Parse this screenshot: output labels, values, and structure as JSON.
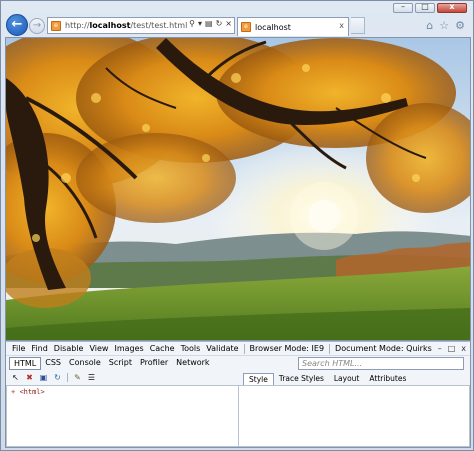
{
  "browser": {
    "window_buttons": {
      "minimize": "–",
      "maximize": "□",
      "close": "x"
    },
    "address": {
      "prefix": "http://",
      "host": "localhost",
      "path": "/test/test.html"
    },
    "tab": {
      "title": "localhost",
      "close": "x"
    },
    "address_icons": [
      "search-icon",
      "chevron-down-icon",
      "compatibility-icon",
      "refresh-icon",
      "close-icon"
    ],
    "command_icons": [
      "home-icon",
      "star-icon",
      "gear-icon"
    ]
  },
  "devtools": {
    "menu": [
      "File",
      "Find",
      "Disable",
      "View",
      "Images",
      "Cache",
      "Tools",
      "Validate"
    ],
    "browser_mode": "Browser Mode: IE9",
    "document_mode": "Document Mode: Quirks",
    "window_buttons": {
      "minimize": "–",
      "popout": "□",
      "close": "x"
    },
    "tabs": [
      "HTML",
      "CSS",
      "Console",
      "Script",
      "Profiler",
      "Network"
    ],
    "active_tab": "HTML",
    "search_placeholder": "Search HTML...",
    "tree": {
      "expander": "+",
      "node": "<html>"
    },
    "right_tabs": [
      "Style",
      "Trace Styles",
      "Layout",
      "Attributes"
    ],
    "active_right_tab": "Style"
  }
}
